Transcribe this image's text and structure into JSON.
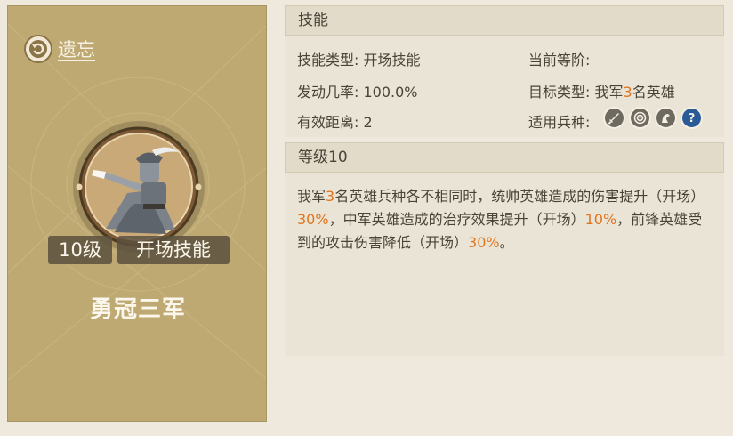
{
  "left_card": {
    "forget_label": "遗忘",
    "level_badge": "10级",
    "skill_type_badge": "开场技能",
    "skill_name": "勇冠三军"
  },
  "skill_panel": {
    "header": "技能",
    "skill_type_label": "技能类型:",
    "skill_type_value": "开场技能",
    "current_rank_label": "当前等阶:",
    "trigger_rate_label": "发动几率:",
    "trigger_rate_value": "100.0%",
    "target_type_label": "目标类型:",
    "target_type_prefix": "我军",
    "target_type_number": "3",
    "target_type_suffix": "名英雄",
    "range_label": "有效距离:",
    "range_value": "2",
    "troop_label": "适用兵种:",
    "troop_icons": [
      "sword-icon",
      "bow-icon",
      "horse-icon",
      "question-icon"
    ]
  },
  "level_panel": {
    "header": "等级10",
    "desc": {
      "p1": "我军",
      "n1": "3",
      "p2": "名英雄兵种各不相同时，统帅英雄造成的伤害提升（开场）",
      "n2": "30%",
      "p3": "，中军英雄造成的治疗效果提升（开场）",
      "n3": "10%",
      "p4": "，前锋英雄受到的攻击伤害降低（开场）",
      "n4": "30%",
      "p5": "。"
    }
  },
  "colors": {
    "card_bg": "#bea973",
    "highlight": "#e0751e",
    "text": "#4a4438"
  }
}
